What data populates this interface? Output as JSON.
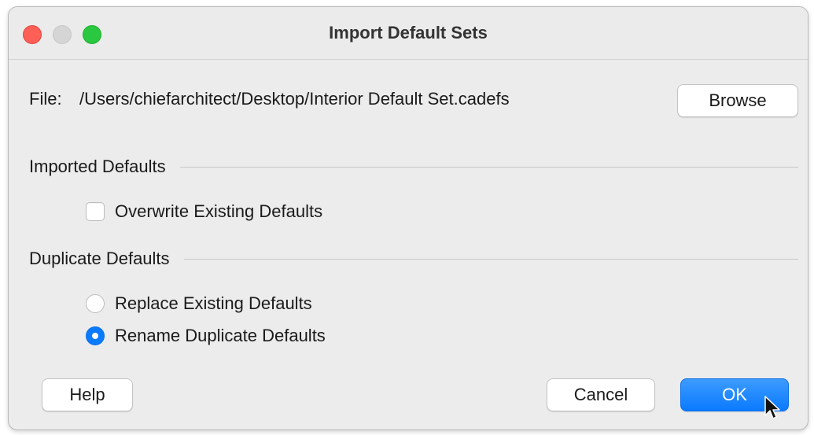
{
  "window": {
    "title": "Import Default Sets"
  },
  "file": {
    "label": "File:",
    "path": "/Users/chiefarchitect/Desktop/Interior Default Set.cadefs",
    "browse_label": "Browse"
  },
  "imported_defaults": {
    "heading": "Imported Defaults",
    "overwrite_label": "Overwrite Existing Defaults",
    "overwrite_checked": false
  },
  "duplicate_defaults": {
    "heading": "Duplicate Defaults",
    "options": [
      {
        "label": "Replace Existing Defaults",
        "selected": false
      },
      {
        "label": "Rename Duplicate Defaults",
        "selected": true
      }
    ]
  },
  "footer": {
    "help_label": "Help",
    "cancel_label": "Cancel",
    "ok_label": "OK"
  },
  "colors": {
    "accent": "#0a7aff",
    "close": "#fe5f57",
    "maximize": "#2ac840"
  }
}
